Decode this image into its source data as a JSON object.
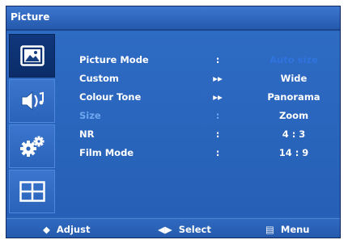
{
  "window": {
    "title": "Picture"
  },
  "sidebar": {
    "items": [
      {
        "name": "picture",
        "icon": "picture-icon",
        "active": true
      },
      {
        "name": "sound",
        "icon": "sound-icon",
        "active": false
      },
      {
        "name": "setup",
        "icon": "gears-icon",
        "active": false
      },
      {
        "name": "pip",
        "icon": "grid-icon",
        "active": false
      }
    ]
  },
  "menu": {
    "rows": [
      {
        "label": "Picture Mode",
        "sep": ":",
        "value": "Auto size"
      },
      {
        "label": "Custom",
        "sep": "▸▸",
        "value": "Wide"
      },
      {
        "label": "Colour Tone",
        "sep": "▸▸",
        "value": "Panorama"
      },
      {
        "label": "Size",
        "sep": ":",
        "value": "Zoom"
      },
      {
        "label": "NR",
        "sep": ":",
        "value": "4 : 3"
      },
      {
        "label": "Film Mode",
        "sep": ":",
        "value": "14 : 9"
      }
    ],
    "selected_index": 3
  },
  "footer": {
    "adjust": {
      "glyph": "◆",
      "label": "Adjust"
    },
    "select": {
      "glyph": "◀▶",
      "label": "Select"
    },
    "menu": {
      "glyph": "▤",
      "label": "Menu"
    }
  },
  "colors": {
    "panel": "#2a62b8",
    "selected_text": "#6ea6f0",
    "dim_value": "#2f74de"
  }
}
